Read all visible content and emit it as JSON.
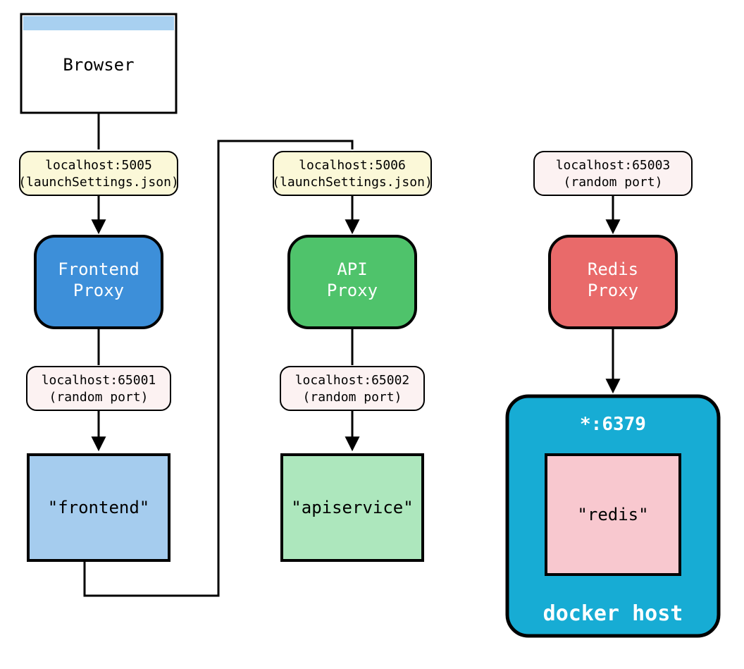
{
  "nodes": {
    "browser": {
      "label": "Browser"
    },
    "port_frontend_proxy": {
      "line1": "localhost:5005",
      "line2": "(launchSettings.json)"
    },
    "port_api_proxy": {
      "line1": "localhost:5006",
      "line2": "(launchSettings.json)"
    },
    "port_redis_proxy": {
      "line1": "localhost:65003",
      "line2": "(random port)"
    },
    "frontend_proxy": {
      "line1": "Frontend",
      "line2": "Proxy"
    },
    "api_proxy": {
      "line1": "API",
      "line2": "Proxy"
    },
    "redis_proxy": {
      "line1": "Redis",
      "line2": "Proxy"
    },
    "port_frontend_svc": {
      "line1": "localhost:65001",
      "line2": "(random port)"
    },
    "port_api_svc": {
      "line1": "localhost:65002",
      "line2": "(random port)"
    },
    "frontend_svc": {
      "label": "\"frontend\""
    },
    "api_svc": {
      "label": "\"apiservice\""
    },
    "redis_svc": {
      "label": "\"redis\""
    },
    "docker_host": {
      "label": "docker host",
      "port": "*:6379"
    }
  },
  "colors": {
    "browser_header": "#A8D0F0",
    "port_yellow": "#FBF8D8",
    "port_pink": "#FCF2F2",
    "proxy_blue": "#3D8FD9",
    "proxy_green": "#4FC36B",
    "proxy_red": "#E96A6A",
    "svc_lightblue": "#A5CCEE",
    "svc_lightgreen": "#ADE7BD",
    "svc_lightpink": "#F8C8CF",
    "docker": "#17ACD4",
    "stroke": "#000000"
  }
}
